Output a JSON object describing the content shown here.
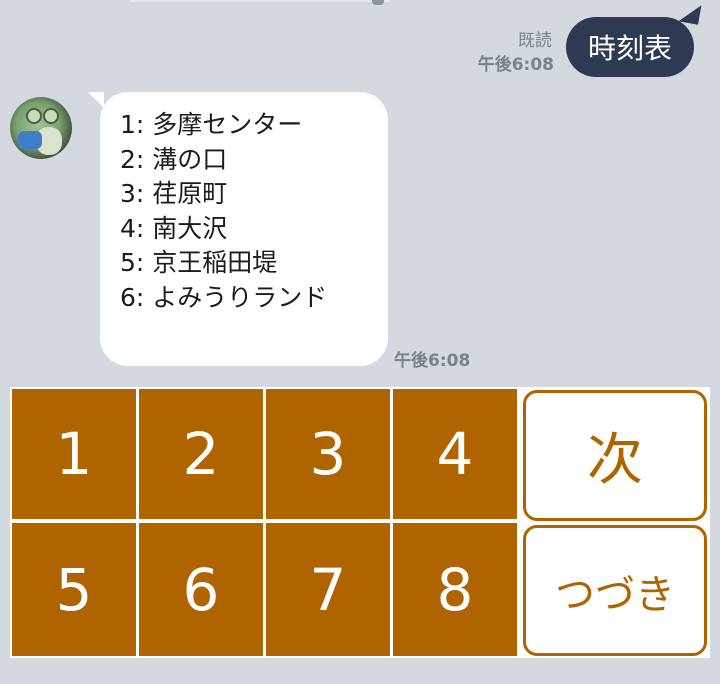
{
  "chat": {
    "outgoing": {
      "text": "時刻表",
      "read_label": "既読",
      "time": "午後6:08"
    },
    "incoming": {
      "lines": [
        "1: 多摩センター",
        "2: 溝の口",
        "3: 荏原町",
        "4: 南大沢",
        "5: 京王稲田堤",
        "6: よみうりランド"
      ],
      "time": "午後6:08"
    }
  },
  "keypad": {
    "keys": [
      "1",
      "2",
      "3",
      "4",
      "5",
      "6",
      "7",
      "8"
    ],
    "next_label": "次",
    "more_label": "つづき"
  },
  "colors": {
    "accent": "#b06400",
    "outgoing_bubble": "#2d3a51",
    "background": "#d4d9e0"
  },
  "icons": {
    "avatar": "frog-avatar"
  }
}
